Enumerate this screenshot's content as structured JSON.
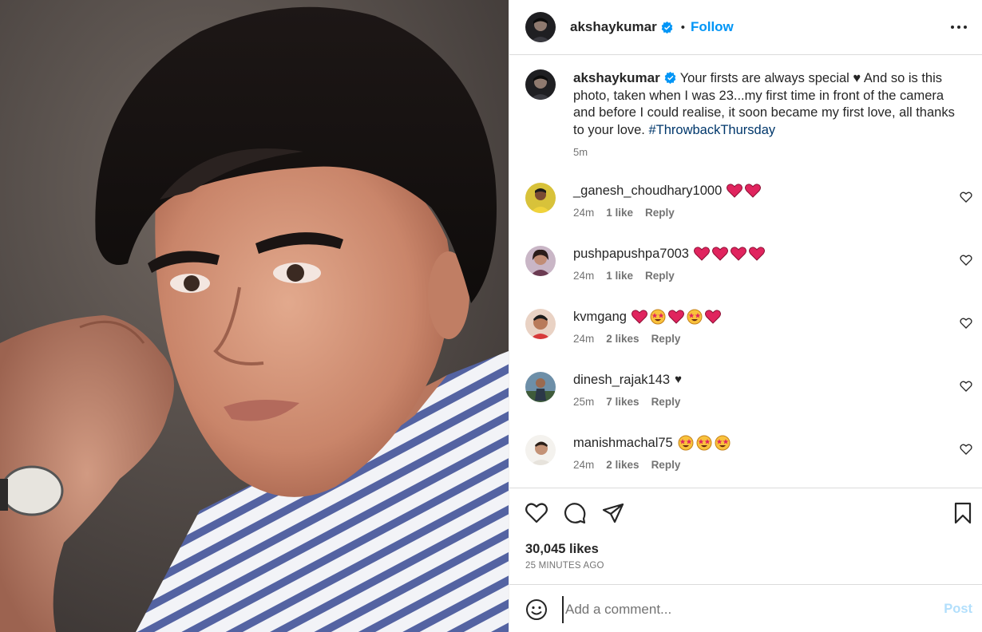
{
  "post": {
    "username": "akshaykumar",
    "follow_label": "Follow",
    "dot": "•",
    "caption_text": "Your firsts are always special ♥ And so is this photo, taken when I was 23...my first time in front of the camera and before I could realise, it soon became my first love, all thanks to your love.",
    "hashtag": "#ThrowbackThursday",
    "caption_time": "5m",
    "likes": "30,045 likes",
    "time_ago": "25 MINUTES AGO"
  },
  "comments": [
    {
      "username": "_ganesh_choudhary1000",
      "emojis": [
        "heart",
        "heart"
      ],
      "time": "24m",
      "likes": "1 like",
      "reply": "Reply"
    },
    {
      "username": "pushpapushpa7003",
      "emojis": [
        "heart",
        "heart",
        "heart",
        "heart"
      ],
      "time": "24m",
      "likes": "1 like",
      "reply": "Reply"
    },
    {
      "username": "kvmgang",
      "emojis": [
        "heart",
        "star-eyes",
        "heart",
        "star-eyes",
        "heart"
      ],
      "time": "24m",
      "likes": "2 likes",
      "reply": "Reply"
    },
    {
      "username": "dinesh_rajak143",
      "text": "♥",
      "emojis": [],
      "time": "25m",
      "likes": "7 likes",
      "reply": "Reply"
    },
    {
      "username": "manishmachal75",
      "emojis": [
        "star-eyes",
        "star-eyes",
        "star-eyes"
      ],
      "time": "24m",
      "likes": "2 likes",
      "reply": "Reply"
    }
  ],
  "comment_box": {
    "placeholder": "Add a comment...",
    "post_label": "Post"
  },
  "icons": {
    "verified": "verified-badge-icon",
    "more": "more-options-icon",
    "like": "heart-outline-icon",
    "comment": "comment-bubble-icon",
    "share": "paper-plane-icon",
    "save": "bookmark-icon",
    "emoji": "smiley-icon"
  },
  "colors": {
    "accent": "#0095f6",
    "hashtag": "#00376b",
    "muted": "#737373",
    "heart": "#e0245e",
    "post_disabled": "#b2dffc"
  }
}
